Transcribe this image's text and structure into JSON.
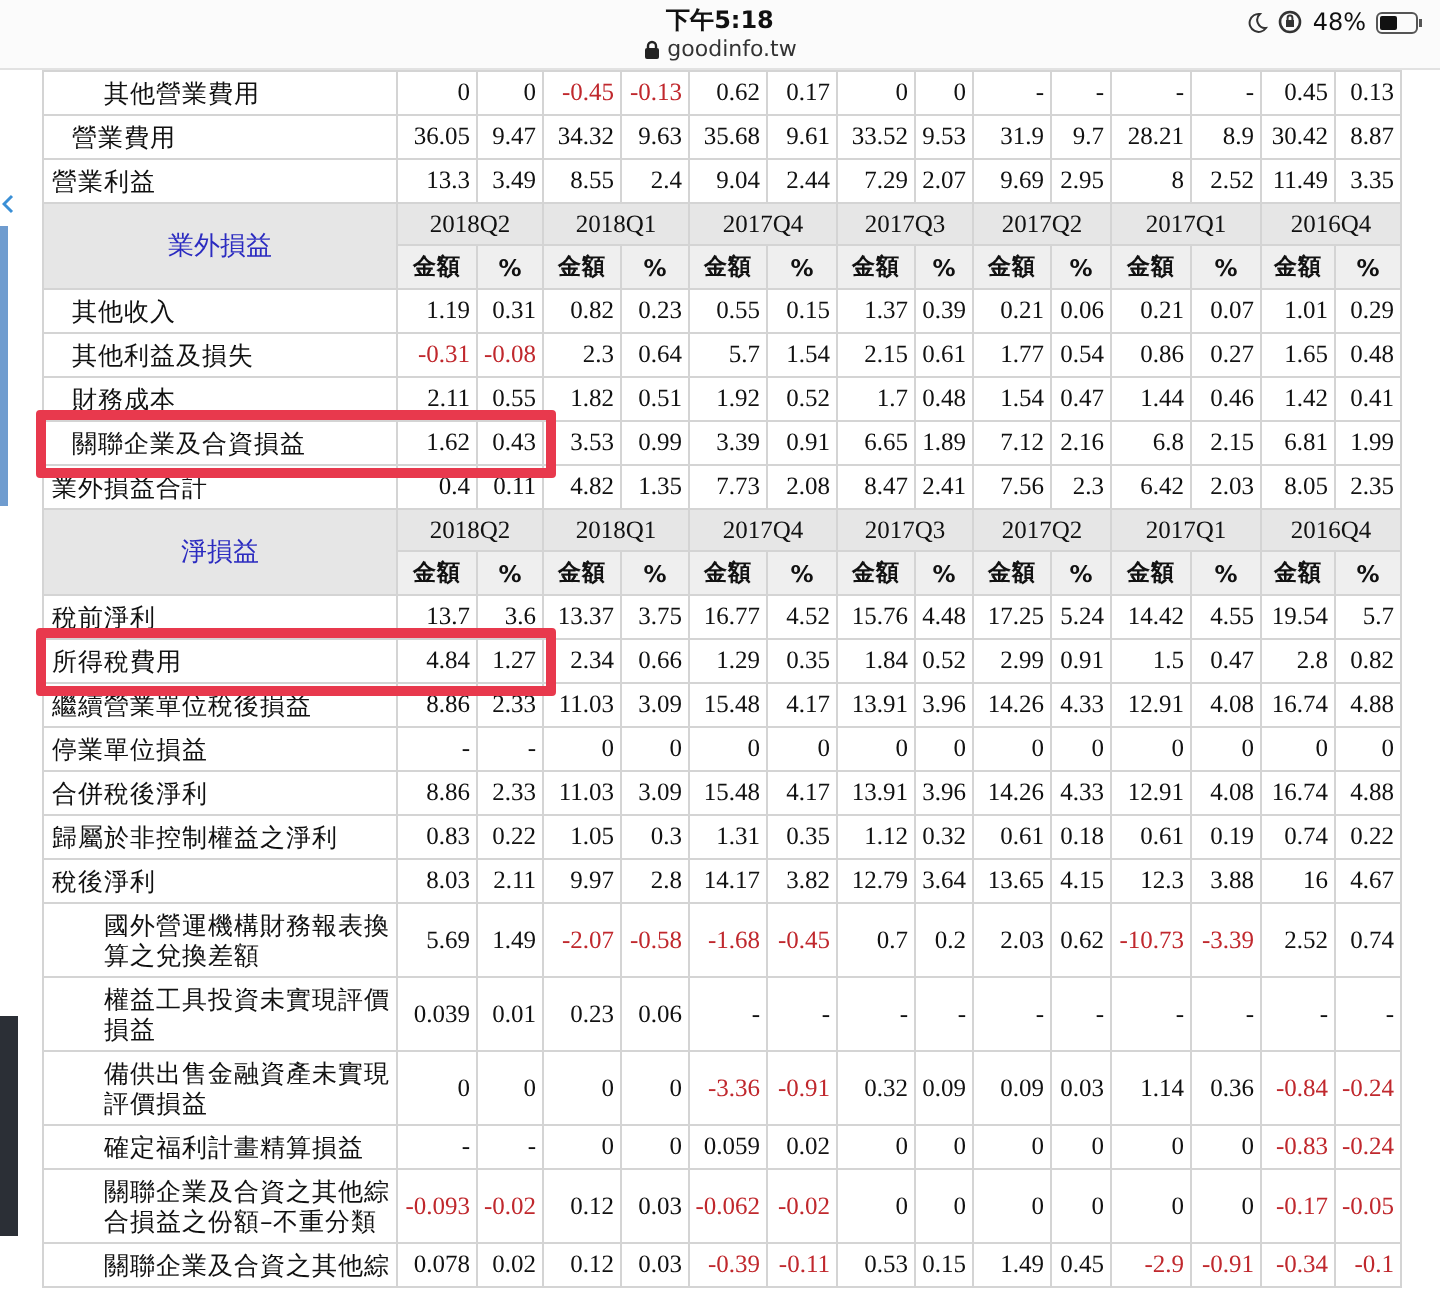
{
  "status_bar": {
    "time": "下午5:18",
    "url": "goodinfo.tw",
    "battery": "48%"
  },
  "table": {
    "blocks": [
      {
        "rows": [
          {
            "label": "其他營業費用",
            "kind": "subitem",
            "highlighted": false,
            "values": [
              "0",
              "0",
              "-0.45",
              "-0.13",
              "0.62",
              "0.17",
              "0",
              "0",
              "-",
              "-",
              "-",
              "-",
              "0.45",
              "0.13"
            ],
            "negative": [
              false,
              false,
              true,
              true,
              false,
              false,
              false,
              false,
              false,
              false,
              false,
              false,
              false,
              false
            ]
          },
          {
            "label": "營業費用",
            "kind": "item",
            "highlighted": false,
            "values": [
              "36.05",
              "9.47",
              "34.32",
              "9.63",
              "35.68",
              "9.61",
              "33.52",
              "9.53",
              "31.9",
              "9.7",
              "28.21",
              "8.9",
              "30.42",
              "8.87"
            ],
            "negative": [
              false,
              false,
              false,
              false,
              false,
              false,
              false,
              false,
              false,
              false,
              false,
              false,
              false,
              false
            ]
          },
          {
            "label": "營業利益",
            "kind": "total",
            "highlighted": false,
            "values": [
              "13.3",
              "3.49",
              "8.55",
              "2.4",
              "9.04",
              "2.44",
              "7.29",
              "2.07",
              "9.69",
              "2.95",
              "8",
              "2.52",
              "11.49",
              "3.35"
            ],
            "negative": [
              false,
              false,
              false,
              false,
              false,
              false,
              false,
              false,
              false,
              false,
              false,
              false,
              false,
              false
            ]
          }
        ]
      },
      {
        "header": {
          "title": "業外損益",
          "periods": [
            "2018Q2",
            "2018Q1",
            "2017Q4",
            "2017Q3",
            "2017Q2",
            "2017Q1",
            "2016Q4"
          ],
          "subcolumns": [
            "金額",
            "%",
            "金額",
            "%",
            "金額",
            "%",
            "金額",
            "%",
            "金額",
            "%",
            "金額",
            "%",
            "金額",
            "%"
          ]
        },
        "rows": [
          {
            "label": "其他收入",
            "kind": "item",
            "highlighted": false,
            "values": [
              "1.19",
              "0.31",
              "0.82",
              "0.23",
              "0.55",
              "0.15",
              "1.37",
              "0.39",
              "0.21",
              "0.06",
              "0.21",
              "0.07",
              "1.01",
              "0.29"
            ],
            "negative": [
              false,
              false,
              false,
              false,
              false,
              false,
              false,
              false,
              false,
              false,
              false,
              false,
              false,
              false
            ]
          },
          {
            "label": "其他利益及損失",
            "kind": "item",
            "highlighted": false,
            "values": [
              "-0.31",
              "-0.08",
              "2.3",
              "0.64",
              "5.7",
              "1.54",
              "2.15",
              "0.61",
              "1.77",
              "0.54",
              "0.86",
              "0.27",
              "1.65",
              "0.48"
            ],
            "negative": [
              true,
              true,
              false,
              false,
              false,
              false,
              false,
              false,
              false,
              false,
              false,
              false,
              false,
              false
            ]
          },
          {
            "label": "財務成本",
            "kind": "item",
            "highlighted": false,
            "values": [
              "2.11",
              "0.55",
              "1.82",
              "0.51",
              "1.92",
              "0.52",
              "1.7",
              "0.48",
              "1.54",
              "0.47",
              "1.44",
              "0.46",
              "1.42",
              "0.41"
            ],
            "negative": [
              false,
              false,
              false,
              false,
              false,
              false,
              false,
              false,
              false,
              false,
              false,
              false,
              false,
              false
            ]
          },
          {
            "label": "關聯企業及合資損益",
            "kind": "item",
            "highlighted": true,
            "values": [
              "1.62",
              "0.43",
              "3.53",
              "0.99",
              "3.39",
              "0.91",
              "6.65",
              "1.89",
              "7.12",
              "2.16",
              "6.8",
              "2.15",
              "6.81",
              "1.99"
            ],
            "negative": [
              false,
              false,
              false,
              false,
              false,
              false,
              false,
              false,
              false,
              false,
              false,
              false,
              false,
              false
            ]
          },
          {
            "label": "業外損益合計",
            "kind": "total",
            "highlighted": false,
            "values": [
              "0.4",
              "0.11",
              "4.82",
              "1.35",
              "7.73",
              "2.08",
              "8.47",
              "2.41",
              "7.56",
              "2.3",
              "6.42",
              "2.03",
              "8.05",
              "2.35"
            ],
            "negative": [
              false,
              false,
              false,
              false,
              false,
              false,
              false,
              false,
              false,
              false,
              false,
              false,
              false,
              false
            ]
          }
        ]
      },
      {
        "header": {
          "title": "淨損益",
          "periods": [
            "2018Q2",
            "2018Q1",
            "2017Q4",
            "2017Q3",
            "2017Q2",
            "2017Q1",
            "2016Q4"
          ],
          "subcolumns": [
            "金額",
            "%",
            "金額",
            "%",
            "金額",
            "%",
            "金額",
            "%",
            "金額",
            "%",
            "金額",
            "%",
            "金額",
            "%"
          ]
        },
        "rows": [
          {
            "label": "稅前淨利",
            "kind": "total",
            "highlighted": false,
            "values": [
              "13.7",
              "3.6",
              "13.37",
              "3.75",
              "16.77",
              "4.52",
              "15.76",
              "4.48",
              "17.25",
              "5.24",
              "14.42",
              "4.55",
              "19.54",
              "5.7"
            ],
            "negative": [
              false,
              false,
              false,
              false,
              false,
              false,
              false,
              false,
              false,
              false,
              false,
              false,
              false,
              false
            ]
          },
          {
            "label": "所得稅費用",
            "kind": "total",
            "highlighted": true,
            "values": [
              "4.84",
              "1.27",
              "2.34",
              "0.66",
              "1.29",
              "0.35",
              "1.84",
              "0.52",
              "2.99",
              "0.91",
              "1.5",
              "0.47",
              "2.8",
              "0.82"
            ],
            "negative": [
              false,
              false,
              false,
              false,
              false,
              false,
              false,
              false,
              false,
              false,
              false,
              false,
              false,
              false
            ]
          },
          {
            "label": "繼續營業單位稅後損益",
            "kind": "total",
            "highlighted": false,
            "values": [
              "8.86",
              "2.33",
              "11.03",
              "3.09",
              "15.48",
              "4.17",
              "13.91",
              "3.96",
              "14.26",
              "4.33",
              "12.91",
              "4.08",
              "16.74",
              "4.88"
            ],
            "negative": [
              false,
              false,
              false,
              false,
              false,
              false,
              false,
              false,
              false,
              false,
              false,
              false,
              false,
              false
            ]
          },
          {
            "label": "停業單位損益",
            "kind": "total",
            "highlighted": false,
            "values": [
              "-",
              "-",
              "0",
              "0",
              "0",
              "0",
              "0",
              "0",
              "0",
              "0",
              "0",
              "0",
              "0",
              "0"
            ],
            "negative": [
              false,
              false,
              false,
              false,
              false,
              false,
              false,
              false,
              false,
              false,
              false,
              false,
              false,
              false
            ]
          },
          {
            "label": "合併稅後淨利",
            "kind": "total",
            "highlighted": false,
            "values": [
              "8.86",
              "2.33",
              "11.03",
              "3.09",
              "15.48",
              "4.17",
              "13.91",
              "3.96",
              "14.26",
              "4.33",
              "12.91",
              "4.08",
              "16.74",
              "4.88"
            ],
            "negative": [
              false,
              false,
              false,
              false,
              false,
              false,
              false,
              false,
              false,
              false,
              false,
              false,
              false,
              false
            ]
          },
          {
            "label": "歸屬於非控制權益之淨利",
            "kind": "total",
            "highlighted": false,
            "values": [
              "0.83",
              "0.22",
              "1.05",
              "0.3",
              "1.31",
              "0.35",
              "1.12",
              "0.32",
              "0.61",
              "0.18",
              "0.61",
              "0.19",
              "0.74",
              "0.22"
            ],
            "negative": [
              false,
              false,
              false,
              false,
              false,
              false,
              false,
              false,
              false,
              false,
              false,
              false,
              false,
              false
            ]
          },
          {
            "label": "稅後淨利",
            "kind": "total",
            "highlighted": false,
            "values": [
              "8.03",
              "2.11",
              "9.97",
              "2.8",
              "14.17",
              "3.82",
              "12.79",
              "3.64",
              "13.65",
              "4.15",
              "12.3",
              "3.88",
              "16",
              "4.67"
            ],
            "negative": [
              false,
              false,
              false,
              false,
              false,
              false,
              false,
              false,
              false,
              false,
              false,
              false,
              false,
              false
            ]
          },
          {
            "label": "國外營運機構財務報表換算之兌換差額",
            "kind": "subitem",
            "highlighted": false,
            "values": [
              "5.69",
              "1.49",
              "-2.07",
              "-0.58",
              "-1.68",
              "-0.45",
              "0.7",
              "0.2",
              "2.03",
              "0.62",
              "-10.73",
              "-3.39",
              "2.52",
              "0.74"
            ],
            "negative": [
              false,
              false,
              true,
              true,
              true,
              true,
              false,
              false,
              false,
              false,
              true,
              true,
              false,
              false
            ]
          },
          {
            "label": "權益工具投資未實現評價損益",
            "kind": "subitem",
            "highlighted": false,
            "values": [
              "0.039",
              "0.01",
              "0.23",
              "0.06",
              "-",
              "-",
              "-",
              "-",
              "-",
              "-",
              "-",
              "-",
              "-",
              "-"
            ],
            "negative": [
              false,
              false,
              false,
              false,
              false,
              false,
              false,
              false,
              false,
              false,
              false,
              false,
              false,
              false
            ]
          },
          {
            "label": "備供出售金融資產未實現評價損益",
            "kind": "subitem",
            "highlighted": false,
            "values": [
              "0",
              "0",
              "0",
              "0",
              "-3.36",
              "-0.91",
              "0.32",
              "0.09",
              "0.09",
              "0.03",
              "1.14",
              "0.36",
              "-0.84",
              "-0.24"
            ],
            "negative": [
              false,
              false,
              false,
              false,
              true,
              true,
              false,
              false,
              false,
              false,
              false,
              false,
              true,
              true
            ]
          },
          {
            "label": "確定福利計畫精算損益",
            "kind": "subitem",
            "highlighted": false,
            "values": [
              "-",
              "-",
              "0",
              "0",
              "0.059",
              "0.02",
              "0",
              "0",
              "0",
              "0",
              "0",
              "0",
              "-0.83",
              "-0.24"
            ],
            "negative": [
              false,
              false,
              false,
              false,
              false,
              false,
              false,
              false,
              false,
              false,
              false,
              false,
              true,
              true
            ]
          },
          {
            "label": "關聯企業及合資之其他綜合損益之份額–不重分類",
            "kind": "subitem",
            "highlighted": false,
            "values": [
              "-0.093",
              "-0.02",
              "0.12",
              "0.03",
              "-0.062",
              "-0.02",
              "0",
              "0",
              "0",
              "0",
              "0",
              "0",
              "-0.17",
              "-0.05"
            ],
            "negative": [
              true,
              true,
              false,
              false,
              true,
              true,
              false,
              false,
              false,
              false,
              false,
              false,
              true,
              true
            ]
          },
          {
            "label": "關聯企業及合資之其他綜",
            "kind": "subitem",
            "highlighted": false,
            "values": [
              "0.078",
              "0.02",
              "0.12",
              "0.03",
              "-0.39",
              "-0.11",
              "0.53",
              "0.15",
              "1.49",
              "0.45",
              "-2.9",
              "-0.91",
              "-0.34",
              "-0.1"
            ],
            "negative": [
              false,
              false,
              false,
              false,
              true,
              true,
              false,
              false,
              false,
              false,
              true,
              true,
              true,
              true
            ]
          }
        ]
      }
    ]
  }
}
